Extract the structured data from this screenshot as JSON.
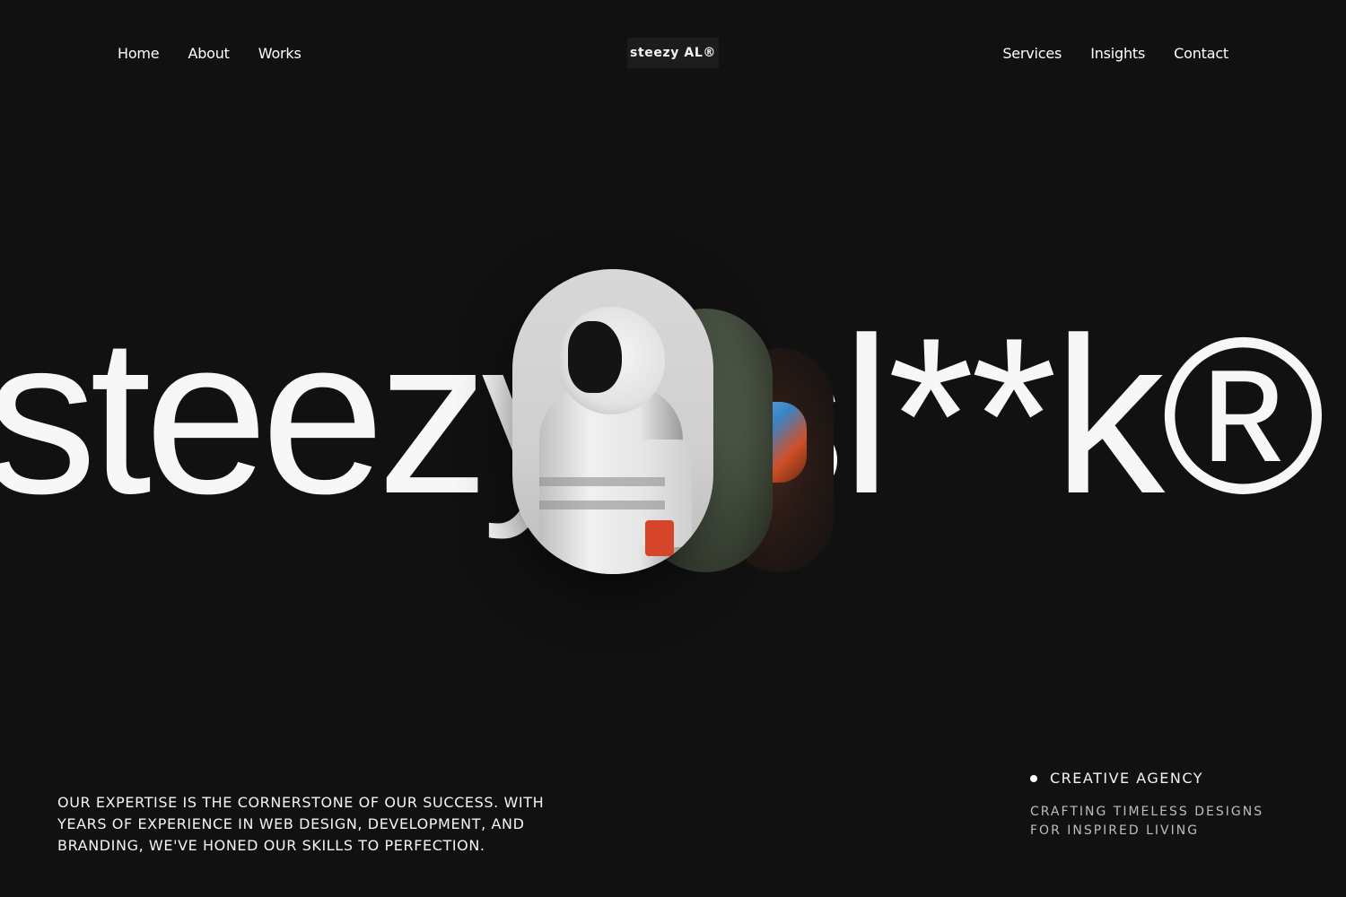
{
  "header": {
    "nav_left": [
      {
        "label": "Home"
      },
      {
        "label": "About"
      },
      {
        "label": "Works"
      }
    ],
    "logo": "steezy AL®",
    "nav_right": [
      {
        "label": "Services"
      },
      {
        "label": "Insights"
      },
      {
        "label": "Contact"
      }
    ]
  },
  "hero": {
    "word_left": "steezy",
    "word_right": "sl**k®"
  },
  "main": {
    "expertise": "Our expertise is the cornerstone of our success. With years of experience in web design, development, and branding, we've honed our skills to perfection.",
    "agency_label": "CREATIVE AGENCY",
    "tagline": "CRAFTING TIMELESS DESIGNS FOR INSPIRED LIVING"
  },
  "colors": {
    "background": "#111111",
    "text": "#ffffff",
    "muted": "#bdbdbd"
  }
}
